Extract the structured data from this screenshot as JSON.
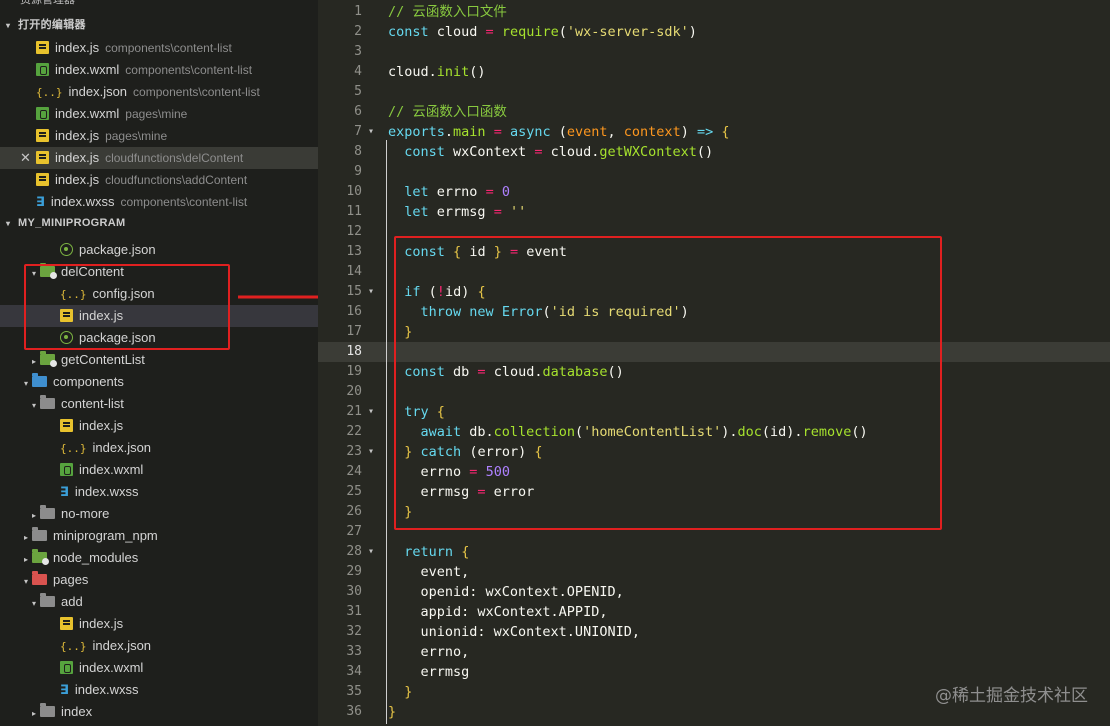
{
  "sidebar": {
    "title": "资源管理器",
    "open_editors_header": "打开的编辑器",
    "project_header": "MY_MINIPROGRAM",
    "open_editors": [
      {
        "name": "index.js",
        "path": "components\\content-list",
        "icon": "js-icon"
      },
      {
        "name": "index.wxml",
        "path": "components\\content-list",
        "icon": "wxml-icon"
      },
      {
        "name": "index.json",
        "path": "components\\content-list",
        "icon": "json-icon"
      },
      {
        "name": "index.wxml",
        "path": "pages\\mine",
        "icon": "wxml-icon"
      },
      {
        "name": "index.js",
        "path": "pages\\mine",
        "icon": "js-icon"
      },
      {
        "name": "index.js",
        "path": "cloudfunctions\\delContent",
        "icon": "js-icon",
        "close": "✕"
      },
      {
        "name": "index.js",
        "path": "cloudfunctions\\addContent",
        "icon": "js-icon"
      },
      {
        "name": "index.wxss",
        "path": "components\\content-list",
        "icon": "wxss-icon"
      }
    ],
    "tree": [
      {
        "name": "package.json",
        "icon": "package-icon",
        "indent": 3
      },
      {
        "name": "delContent",
        "icon": "cloud-folder-icon",
        "indent": 2,
        "caret": "▾"
      },
      {
        "name": "config.json",
        "icon": "json-icon",
        "indent": 3
      },
      {
        "name": "index.js",
        "icon": "js-icon",
        "indent": 3
      },
      {
        "name": "package.json",
        "icon": "package-icon",
        "indent": 3
      },
      {
        "name": "getContentList",
        "icon": "cloud-folder-icon",
        "indent": 2,
        "caret": "▸"
      },
      {
        "name": "components",
        "icon": "components-folder-icon",
        "indent": 1,
        "caret": "▾"
      },
      {
        "name": "content-list",
        "icon": "folder-icon",
        "indent": 2,
        "caret": "▾"
      },
      {
        "name": "index.js",
        "icon": "js-icon",
        "indent": 3
      },
      {
        "name": "index.json",
        "icon": "json-icon",
        "indent": 3
      },
      {
        "name": "index.wxml",
        "icon": "wxml-icon",
        "indent": 3
      },
      {
        "name": "index.wxss",
        "icon": "wxss-icon",
        "indent": 3
      },
      {
        "name": "no-more",
        "icon": "folder-icon",
        "indent": 2,
        "caret": "▸"
      },
      {
        "name": "miniprogram_npm",
        "icon": "folder-icon",
        "indent": 1,
        "caret": "▸"
      },
      {
        "name": "node_modules",
        "icon": "cloud-folder-icon",
        "indent": 1,
        "caret": "▸"
      },
      {
        "name": "pages",
        "icon": "pages-folder-icon",
        "indent": 1,
        "caret": "▾"
      },
      {
        "name": "add",
        "icon": "folder-icon",
        "indent": 2,
        "caret": "▾"
      },
      {
        "name": "index.js",
        "icon": "js-icon",
        "indent": 3
      },
      {
        "name": "index.json",
        "icon": "json-icon",
        "indent": 3
      },
      {
        "name": "index.wxml",
        "icon": "wxml-icon",
        "indent": 3
      },
      {
        "name": "index.wxss",
        "icon": "wxss-icon",
        "indent": 3
      },
      {
        "name": "index",
        "icon": "folder-icon",
        "indent": 2,
        "caret": "▸"
      }
    ]
  },
  "editor": {
    "current_line": 18,
    "lines": [
      {
        "n": "1",
        "t": [
          [
            "c",
            "// 云函数入口文件"
          ]
        ]
      },
      {
        "n": "2",
        "t": [
          [
            "k",
            "const"
          ],
          [
            "p",
            " cloud "
          ],
          [
            "o",
            "="
          ],
          [
            "p",
            " "
          ],
          [
            "f",
            "require"
          ],
          [
            "p",
            "("
          ],
          [
            "s",
            "'wx-server-sdk'"
          ],
          [
            "p",
            ")"
          ]
        ]
      },
      {
        "n": "3",
        "t": []
      },
      {
        "n": "4",
        "t": [
          [
            "p",
            "cloud."
          ],
          [
            "f",
            "init"
          ],
          [
            "p",
            "()"
          ]
        ]
      },
      {
        "n": "5",
        "t": []
      },
      {
        "n": "6",
        "t": [
          [
            "c",
            "// 云函数入口函数"
          ]
        ]
      },
      {
        "n": "7",
        "fold": "▾",
        "t": [
          [
            "k",
            "exports"
          ],
          [
            "p",
            "."
          ],
          [
            "f",
            "main"
          ],
          [
            "p",
            " "
          ],
          [
            "o",
            "="
          ],
          [
            "p",
            " "
          ],
          [
            "k",
            "async"
          ],
          [
            "p",
            " ("
          ],
          [
            "a",
            "event"
          ],
          [
            "p",
            ", "
          ],
          [
            "a",
            "context"
          ],
          [
            "p",
            ") "
          ],
          [
            "k",
            "=>"
          ],
          [
            "p",
            " "
          ],
          [
            "b",
            "{"
          ]
        ]
      },
      {
        "n": "8",
        "t": [
          [
            "p",
            "  "
          ],
          [
            "k",
            "const"
          ],
          [
            "p",
            " wxContext "
          ],
          [
            "o",
            "="
          ],
          [
            "p",
            " cloud."
          ],
          [
            "f",
            "getWXContext"
          ],
          [
            "p",
            "()"
          ]
        ]
      },
      {
        "n": "9",
        "t": []
      },
      {
        "n": "10",
        "t": [
          [
            "p",
            "  "
          ],
          [
            "k",
            "let"
          ],
          [
            "p",
            " errno "
          ],
          [
            "o",
            "="
          ],
          [
            "p",
            " "
          ],
          [
            "n",
            "0"
          ]
        ]
      },
      {
        "n": "11",
        "t": [
          [
            "p",
            "  "
          ],
          [
            "k",
            "let"
          ],
          [
            "p",
            " errmsg "
          ],
          [
            "o",
            "="
          ],
          [
            "p",
            " "
          ],
          [
            "s",
            "''"
          ]
        ]
      },
      {
        "n": "12",
        "t": []
      },
      {
        "n": "13",
        "t": [
          [
            "p",
            "  "
          ],
          [
            "k",
            "const"
          ],
          [
            "p",
            " "
          ],
          [
            "b",
            "{"
          ],
          [
            "p",
            " id "
          ],
          [
            "b",
            "}"
          ],
          [
            "p",
            " "
          ],
          [
            "o",
            "="
          ],
          [
            "p",
            " event"
          ]
        ]
      },
      {
        "n": "14",
        "t": []
      },
      {
        "n": "15",
        "fold": "▾",
        "t": [
          [
            "p",
            "  "
          ],
          [
            "k",
            "if"
          ],
          [
            "p",
            " ("
          ],
          [
            "o",
            "!"
          ],
          [
            "p",
            "id) "
          ],
          [
            "b",
            "{"
          ]
        ]
      },
      {
        "n": "16",
        "t": [
          [
            "p",
            "    "
          ],
          [
            "k",
            "throw"
          ],
          [
            "p",
            " "
          ],
          [
            "k",
            "new"
          ],
          [
            "p",
            " "
          ],
          [
            "k",
            "Error"
          ],
          [
            "p",
            "("
          ],
          [
            "s",
            "'id is required'"
          ],
          [
            "p",
            ")"
          ]
        ]
      },
      {
        "n": "17",
        "t": [
          [
            "p",
            "  "
          ],
          [
            "b",
            "}"
          ]
        ]
      },
      {
        "n": "18",
        "t": []
      },
      {
        "n": "19",
        "t": [
          [
            "p",
            "  "
          ],
          [
            "k",
            "const"
          ],
          [
            "p",
            " db "
          ],
          [
            "o",
            "="
          ],
          [
            "p",
            " cloud."
          ],
          [
            "f",
            "database"
          ],
          [
            "p",
            "()"
          ]
        ]
      },
      {
        "n": "20",
        "t": []
      },
      {
        "n": "21",
        "fold": "▾",
        "t": [
          [
            "p",
            "  "
          ],
          [
            "k",
            "try"
          ],
          [
            "p",
            " "
          ],
          [
            "b",
            "{"
          ]
        ]
      },
      {
        "n": "22",
        "t": [
          [
            "p",
            "    "
          ],
          [
            "k",
            "await"
          ],
          [
            "p",
            " db."
          ],
          [
            "f",
            "collection"
          ],
          [
            "p",
            "("
          ],
          [
            "s",
            "'homeContentList'"
          ],
          [
            "p",
            ")."
          ],
          [
            "f",
            "doc"
          ],
          [
            "p",
            "(id)."
          ],
          [
            "f",
            "remove"
          ],
          [
            "p",
            "()"
          ]
        ]
      },
      {
        "n": "23",
        "fold": "▾",
        "t": [
          [
            "p",
            "  "
          ],
          [
            "b",
            "}"
          ],
          [
            "p",
            " "
          ],
          [
            "k",
            "catch"
          ],
          [
            "p",
            " ("
          ],
          [
            "p",
            "error"
          ],
          [
            "p",
            ") "
          ],
          [
            "b",
            "{"
          ]
        ]
      },
      {
        "n": "24",
        "t": [
          [
            "p",
            "    errno "
          ],
          [
            "o",
            "="
          ],
          [
            "p",
            " "
          ],
          [
            "n",
            "500"
          ]
        ]
      },
      {
        "n": "25",
        "t": [
          [
            "p",
            "    errmsg "
          ],
          [
            "o",
            "="
          ],
          [
            "p",
            " error"
          ]
        ]
      },
      {
        "n": "26",
        "t": [
          [
            "p",
            "  "
          ],
          [
            "b",
            "}"
          ]
        ]
      },
      {
        "n": "27",
        "t": []
      },
      {
        "n": "28",
        "fold": "▾",
        "t": [
          [
            "p",
            "  "
          ],
          [
            "k",
            "return"
          ],
          [
            "p",
            " "
          ],
          [
            "b",
            "{"
          ]
        ]
      },
      {
        "n": "29",
        "t": [
          [
            "p",
            "    event,"
          ]
        ]
      },
      {
        "n": "30",
        "t": [
          [
            "p",
            "    openid: wxContext.OPENID,"
          ]
        ]
      },
      {
        "n": "31",
        "t": [
          [
            "p",
            "    appid: wxContext.APPID,"
          ]
        ]
      },
      {
        "n": "32",
        "t": [
          [
            "p",
            "    unionid: wxContext.UNIONID,"
          ]
        ]
      },
      {
        "n": "33",
        "t": [
          [
            "p",
            "    errno,"
          ]
        ]
      },
      {
        "n": "34",
        "t": [
          [
            "p",
            "    errmsg"
          ]
        ]
      },
      {
        "n": "35",
        "t": [
          [
            "p",
            "  "
          ],
          [
            "b",
            "}"
          ]
        ]
      },
      {
        "n": "36",
        "t": [
          [
            "b",
            "}"
          ]
        ]
      }
    ]
  },
  "watermark": "@稀土掘金技术社区",
  "colors": {
    "editor_bg": "#272822",
    "sidebar_bg": "#1e1f1c",
    "highlight_red": "#e02020"
  }
}
